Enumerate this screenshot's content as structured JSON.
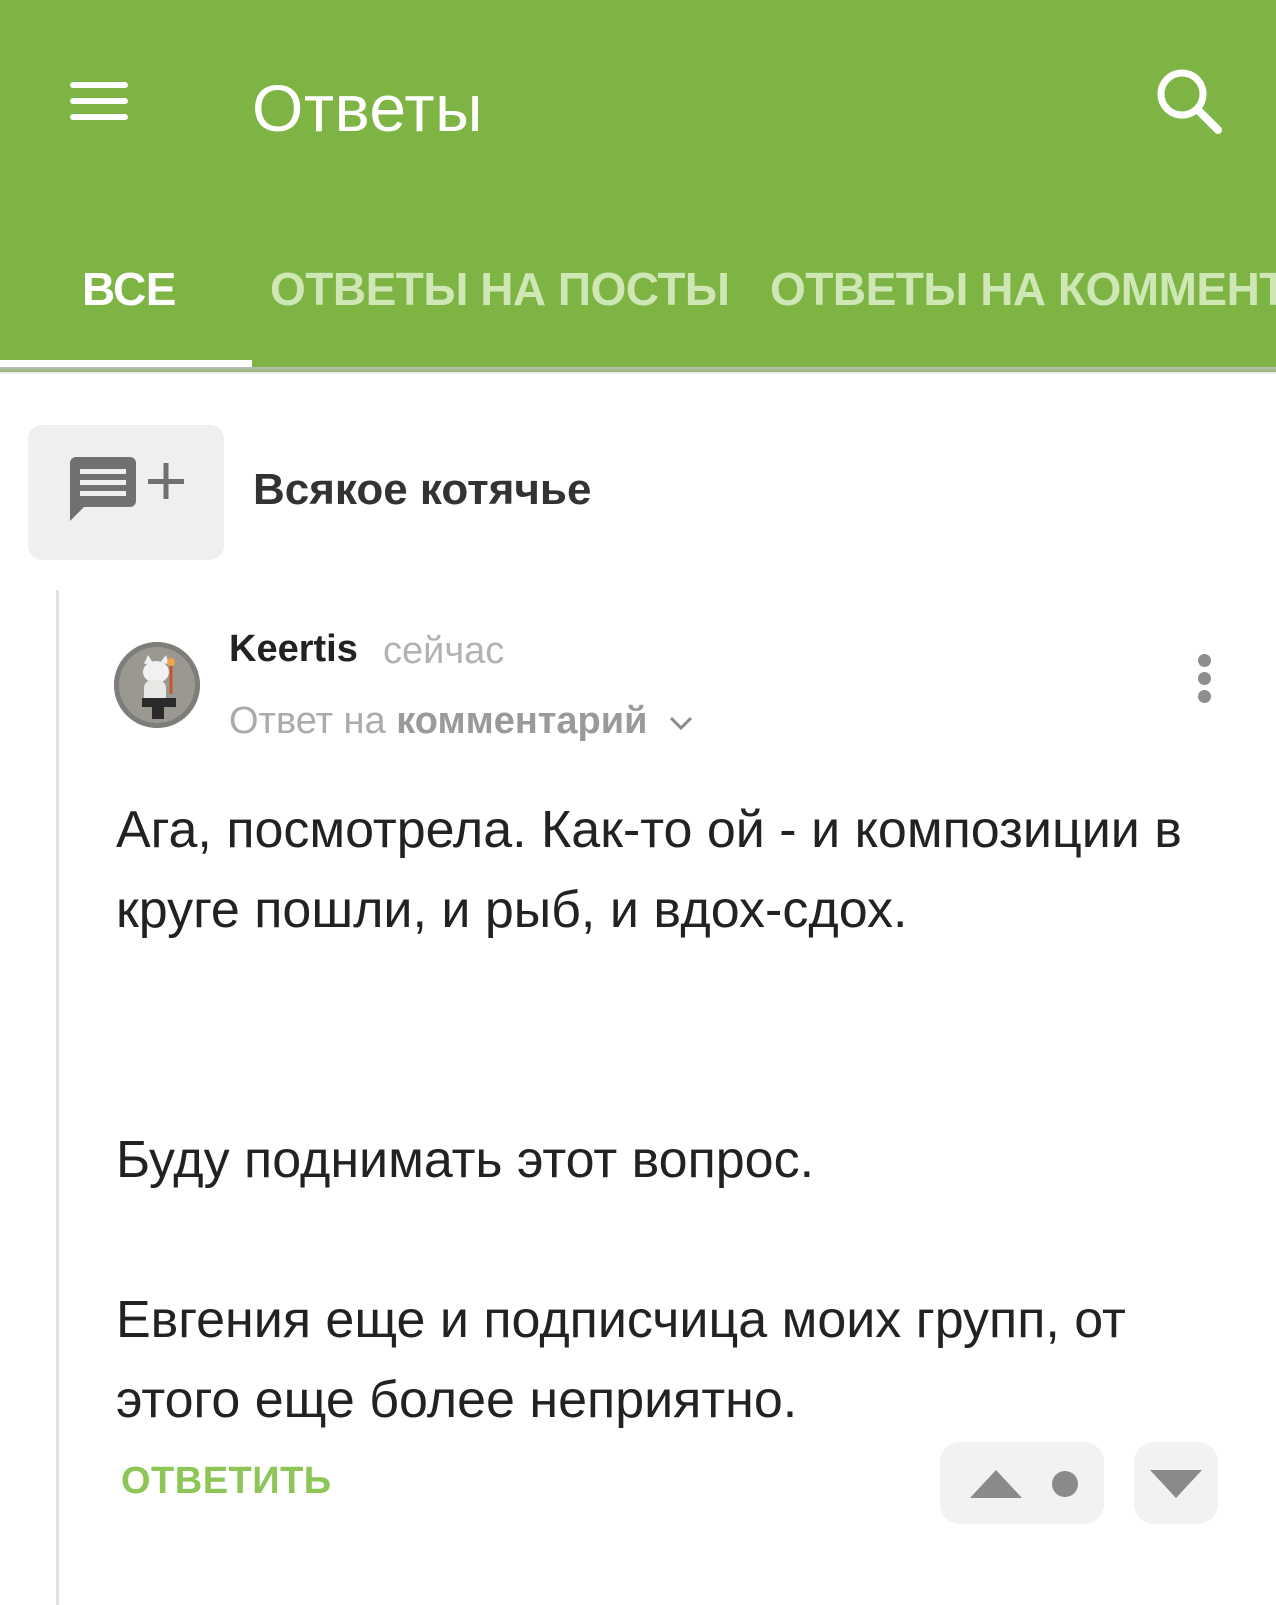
{
  "app": {
    "title": "Ответы",
    "accent_color": "#7eb444",
    "icons": {
      "menu": "hamburger-icon",
      "search": "search-icon"
    }
  },
  "tabs": [
    {
      "label": "ВСЕ",
      "active": true
    },
    {
      "label": "ОТВЕТЫ НА ПОСТЫ",
      "active": false
    },
    {
      "label": "ОТВЕТЫ НА КОММЕНТ",
      "active": false
    }
  ],
  "post": {
    "title": "Всякое котячье",
    "icon": "comment-add-icon"
  },
  "comment": {
    "author": "Keertis",
    "time": "сейчас",
    "reply_prefix": "Ответ на",
    "reply_target": "комментарий",
    "paragraphs": [
      "Ага, посмотрела. Как-то ой - и композиции в круге пошли, и рыб, и вдох-сдох.",
      "Буду поднимать этот вопрос.",
      "Евгения еще и подписчица моих групп, от этого еще более неприятно."
    ],
    "reply_label": "ОТВЕТИТЬ",
    "reply_color": "#8dc657"
  }
}
